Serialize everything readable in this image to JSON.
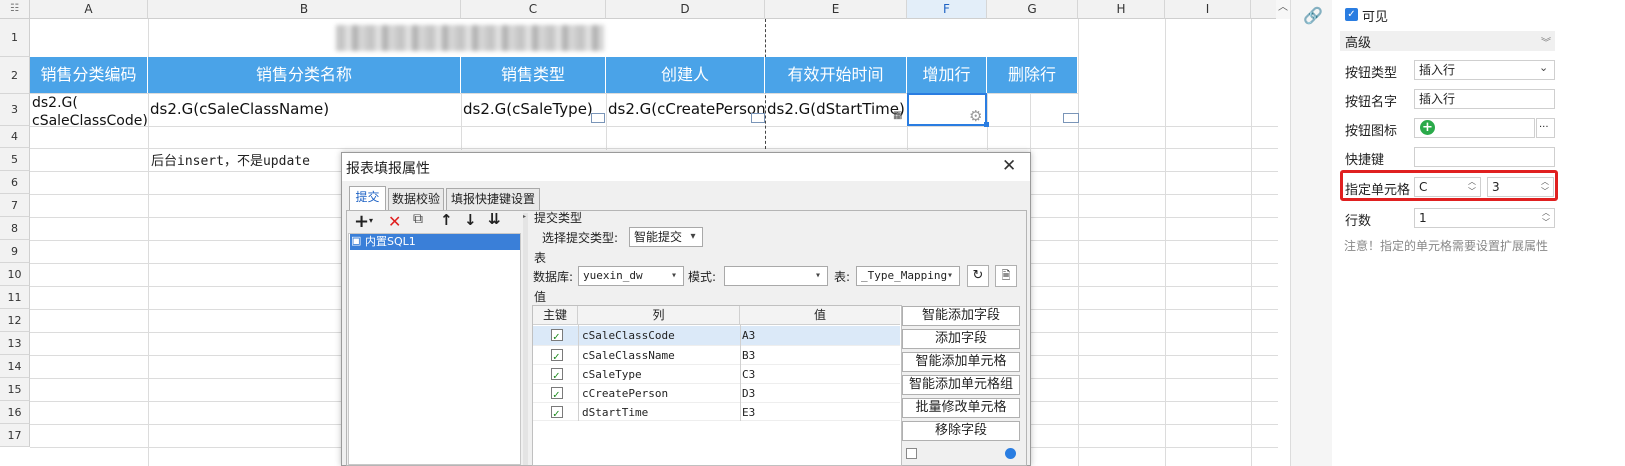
{
  "sheet": {
    "columns": [
      "A",
      "B",
      "C",
      "D",
      "E",
      "F",
      "G",
      "H",
      "I"
    ],
    "rows": [
      "1",
      "2",
      "3",
      "4",
      "5",
      "6",
      "7",
      "8",
      "9",
      "10",
      "11",
      "12",
      "13",
      "14",
      "15",
      "16",
      "17"
    ],
    "headers": [
      "销售分类编码",
      "销售分类名称",
      "销售类型",
      "创建人",
      "有效开始时间",
      "增加行",
      "删除行"
    ],
    "row3": [
      "ds2.G(\ncSaleClassCode)",
      "ds2.G(cSaleClassName)",
      "ds2.G(cSaleType)",
      "ds2.G(cCreatePerson)",
      "ds2.G(dStartTime)"
    ],
    "note_b5": "后台insert，不是update",
    "header_color": "#4aa3e8"
  },
  "dialog": {
    "title": "报表填报属性",
    "close": "✕",
    "tabs": [
      "提交",
      "数据校验",
      "填报快捷键设置"
    ],
    "tree_item": "内置SQL1",
    "submit_type_group": "提交类型",
    "submit_type_label": "选择提交类型:",
    "submit_type_value": "智能提交",
    "table_group": "表",
    "db_label": "数据库:",
    "db_value": "yuexin_dw",
    "mode_label": "模式:",
    "mode_value": "",
    "table_label": "表:",
    "table_value": "_Type_Mapping",
    "value_group": "值",
    "grid_headers": [
      "主键",
      "列",
      "值"
    ],
    "grid_rows": [
      {
        "col": "cSaleClassCode",
        "val": "A3"
      },
      {
        "col": "cSaleClassName",
        "val": "B3"
      },
      {
        "col": "cSaleType",
        "val": "C3"
      },
      {
        "col": "cCreatePerson",
        "val": "D3"
      },
      {
        "col": "dStartTime",
        "val": "E3"
      }
    ],
    "buttons": [
      "智能添加字段",
      "添加字段",
      "智能添加单元格",
      "智能添加单元格组",
      "批量修改单元格",
      "移除字段"
    ]
  },
  "panel": {
    "visible_label": "可见",
    "section": "高级",
    "button_type_label": "按钮类型",
    "button_type_value": "插入行",
    "button_name_label": "按钮名字",
    "button_name_value": "插入行",
    "button_icon_label": "按钮图标",
    "button_icon_more": "···",
    "shortcut_label": "快捷键",
    "cell_label": "指定单元格",
    "cell_col": "C",
    "cell_row": "3",
    "rows_label": "行数",
    "rows_value": "1",
    "note": "注意！指定的单元格需要设置扩展属性",
    "highlight_color": "#e02020"
  }
}
